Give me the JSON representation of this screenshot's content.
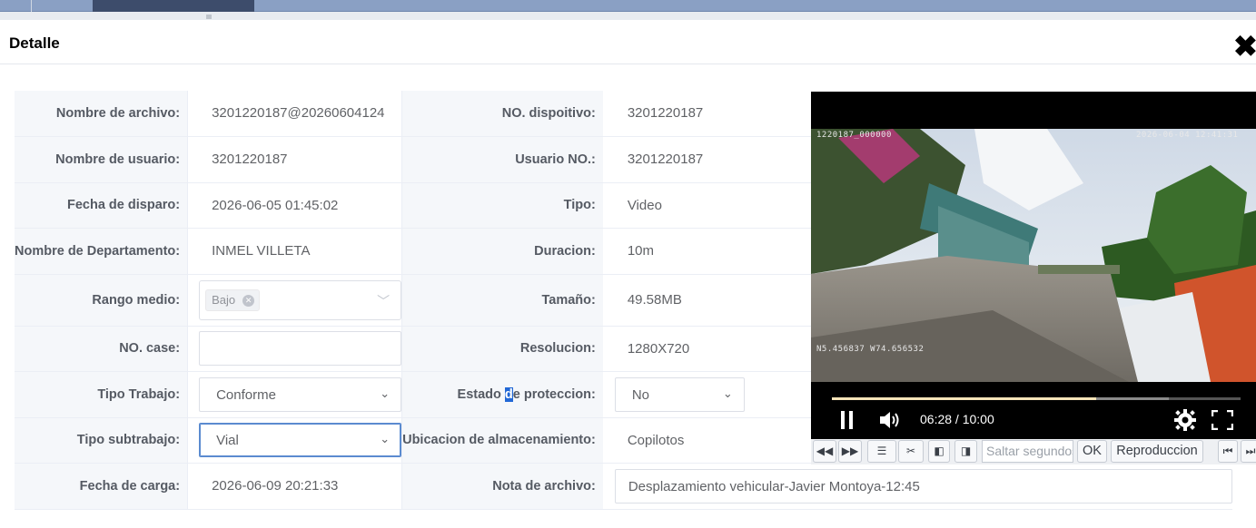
{
  "dialog": {
    "title": "Detalle",
    "close_icon": "close-icon"
  },
  "left": {
    "file_name": {
      "label": "Nombre de archivo:",
      "value": "3201220187@20260604124"
    },
    "user_name": {
      "label": "Nombre de usuario:",
      "value": "3201220187"
    },
    "trigger_date": {
      "label": "Fecha de disparo:",
      "value": "2026-06-05 01:45:02"
    },
    "department": {
      "label": "Nombre de Departamento:",
      "value": "INMEL VILLETA"
    },
    "range": {
      "label": "Rango medio:",
      "tag": "Bajo"
    },
    "case_no": {
      "label": "NO. case:",
      "value": ""
    },
    "work_type": {
      "label": "Tipo Trabajo:",
      "value": "Conforme"
    },
    "sub_type": {
      "label": "Tipo subtrabajo:",
      "value": "Vial"
    },
    "upload_date": {
      "label": "Fecha de carga:",
      "value": "2026-06-09 20:21:33"
    }
  },
  "right": {
    "device_no": {
      "label": "NO. dispoitivo:",
      "value": "3201220187"
    },
    "user_no": {
      "label": "Usuario NO.:",
      "value": "3201220187"
    },
    "type": {
      "label": "Tipo:",
      "value": "Video"
    },
    "duration": {
      "label": "Duracion:",
      "value": "10m"
    },
    "size": {
      "label": "Tamaño:",
      "value": "49.58MB"
    },
    "resolution": {
      "label": "Resolucion:",
      "value": "1280X720"
    },
    "protection": {
      "label_pre": "Estado ",
      "label_hl": "d",
      "label_post": "e proteccion:",
      "value": "No"
    },
    "storage": {
      "label": "Ubicacion de almacenamiento:",
      "value": "Copilotos"
    },
    "note": {
      "label": "Nota de archivo:",
      "value": "Desplazamiento vehicular-Javier Montoya-12:45"
    }
  },
  "player": {
    "osd_id": "1220187_000000",
    "osd_time": "2026-06-04 12:41:31",
    "osd_gps": "N5.456837 W74.656532",
    "time": "06:28 / 10:00",
    "progress": 0.647,
    "buffered": 0.824
  },
  "playbar": {
    "seek_placeholder": "Saltar segundos",
    "ok": "OK",
    "playback": "Reproduccion"
  }
}
